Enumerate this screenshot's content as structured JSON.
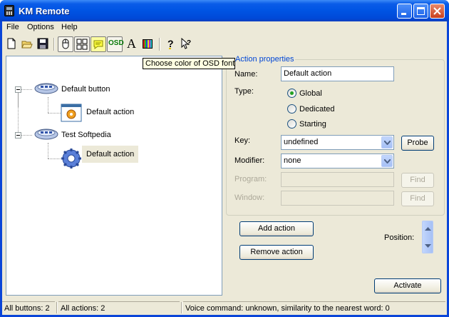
{
  "window": {
    "title": "KM Remote"
  },
  "menu": {
    "items": [
      "File",
      "Options",
      "Help"
    ]
  },
  "toolbar": {
    "buttons": [
      "new-file-icon",
      "open-folder-icon",
      "save-icon",
      "mouse-icon",
      "grid-icon",
      "speech-icon",
      "osd-icon",
      "font-icon",
      "color-bars-icon",
      "help-icon",
      "whats-this-icon"
    ],
    "osd_label": "OSD",
    "font_label": "A",
    "tooltip": "Choose color of OSD font"
  },
  "tree": {
    "nodes": [
      {
        "label": "Default button",
        "children": [
          {
            "label": "Default action"
          }
        ]
      },
      {
        "label": "Test Softpedia",
        "children": [
          {
            "label": "Default action"
          }
        ]
      }
    ]
  },
  "properties": {
    "group_title": "Action properties",
    "name_label": "Name:",
    "name_value": "Default action",
    "type_label": "Type:",
    "type_options": [
      "Global",
      "Dedicated",
      "Starting"
    ],
    "type_selected": "Global",
    "key_label": "Key:",
    "key_value": "undefined",
    "probe_button": "Probe",
    "modifier_label": "Modifier:",
    "modifier_value": "none",
    "program_label": "Program:",
    "program_value": "",
    "window_label": "Window:",
    "window_value": "",
    "find_button": "Find"
  },
  "actions": {
    "add_button": "Add action",
    "remove_button": "Remove action",
    "position_label": "Position:",
    "activate_button": "Activate"
  },
  "status": {
    "buttons": "All buttons: 2",
    "actions": "All actions: 2",
    "voice": "Voice command: unknown, similarity to the nearest word: 0"
  },
  "colors": {
    "titlebar": "#0054e3",
    "window_bg": "#ece9d8",
    "group_title": "#0046d5",
    "radio_dot": "#21a121"
  }
}
